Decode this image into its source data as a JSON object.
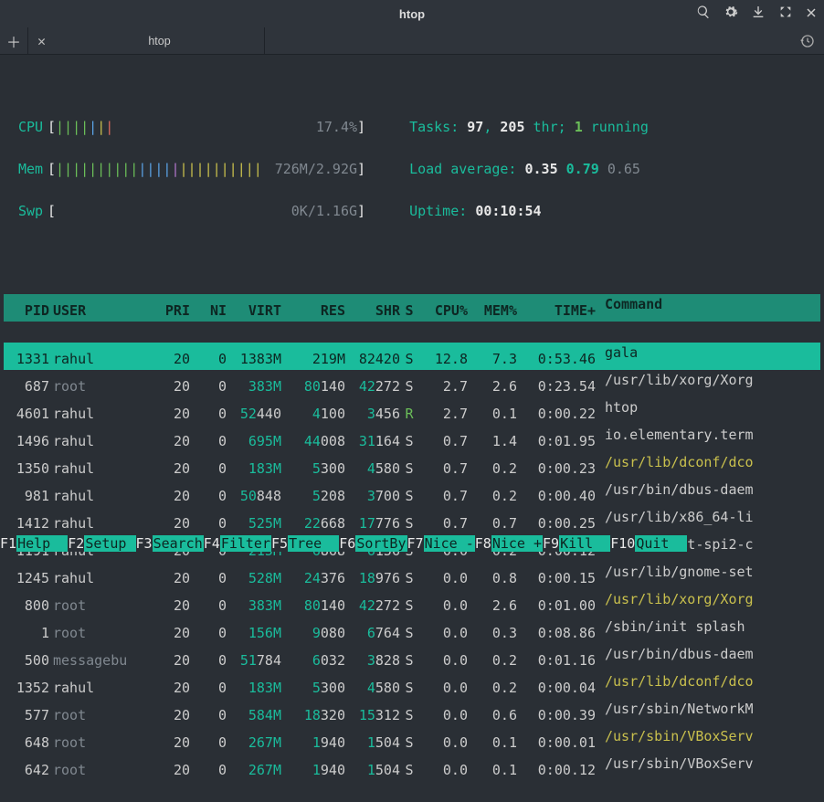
{
  "window": {
    "title": "htop"
  },
  "tab": {
    "label": "htop"
  },
  "meters": {
    "cpu": {
      "label": "CPU",
      "bars": "|||||||",
      "value": "17.4%"
    },
    "mem": {
      "label": "Mem",
      "bars": "|||||||||||||||||||||||||",
      "value": "726M/2.92G"
    },
    "swp": {
      "label": "Swp",
      "bars": "",
      "value": "0K/1.16G"
    }
  },
  "stats": {
    "tasks_label": "Tasks: ",
    "tasks_count": "97",
    "thr_label": ", ",
    "thr_count": "205",
    "thr_suffix": " thr; ",
    "running_count": "1",
    "running_label": " running",
    "load_label": "Load average: ",
    "load1": "0.35",
    "load5": "0.79",
    "load15": "0.65",
    "uptime_label": "Uptime: ",
    "uptime": "00:10:54"
  },
  "columns": {
    "pid": "PID",
    "user": "USER",
    "pri": "PRI",
    "ni": "NI",
    "virt": "VIRT",
    "res": "RES",
    "shr": "SHR",
    "s": "S",
    "cpu": "CPU%",
    "mem": "MEM%",
    "time": "TIME+",
    "cmd": "Command"
  },
  "processes": [
    {
      "pid": "1331",
      "user": "rahul",
      "user_cls": "",
      "pri": "20",
      "ni": "0",
      "virt_hi": "1383M",
      "virt_lo": "",
      "res_hi": "219M",
      "res_lo": "",
      "shr_hi": "82",
      "shr_lo": "420",
      "s": "S",
      "s_cls": "",
      "cpu": "12.8",
      "mem": "7.3",
      "time": "0:53.46",
      "cmd": "gala",
      "cmd_cls": "",
      "sel": true
    },
    {
      "pid": "687",
      "user": "root",
      "user_cls": "gr",
      "pri": "20",
      "ni": "0",
      "virt_hi": "383M",
      "virt_lo": "",
      "res_hi": "80",
      "res_lo": "140",
      "shr_hi": "42",
      "shr_lo": "272",
      "s": "S",
      "s_cls": "",
      "cpu": "2.7",
      "mem": "2.6",
      "time": "0:23.54",
      "cmd": "/usr/lib/xorg/Xorg",
      "cmd_cls": ""
    },
    {
      "pid": "4601",
      "user": "rahul",
      "user_cls": "",
      "pri": "20",
      "ni": "0",
      "virt_hi": "52",
      "virt_lo": "440",
      "res_hi": "4",
      "res_lo": "100",
      "shr_hi": "3",
      "shr_lo": "456",
      "s": "R",
      "s_cls": "grn",
      "cpu": "2.7",
      "mem": "0.1",
      "time": "0:00.22",
      "cmd": "htop",
      "cmd_cls": ""
    },
    {
      "pid": "1496",
      "user": "rahul",
      "user_cls": "",
      "pri": "20",
      "ni": "0",
      "virt_hi": "695M",
      "virt_lo": "",
      "res_hi": "44",
      "res_lo": "008",
      "shr_hi": "31",
      "shr_lo": "164",
      "s": "S",
      "s_cls": "",
      "cpu": "0.7",
      "mem": "1.4",
      "time": "0:01.95",
      "cmd": "io.elementary.term",
      "cmd_cls": ""
    },
    {
      "pid": "1350",
      "user": "rahul",
      "user_cls": "",
      "pri": "20",
      "ni": "0",
      "virt_hi": "183M",
      "virt_lo": "",
      "res_hi": "5",
      "res_lo": "300",
      "shr_hi": "4",
      "shr_lo": "580",
      "s": "S",
      "s_cls": "",
      "cpu": "0.7",
      "mem": "0.2",
      "time": "0:00.23",
      "cmd": "/usr/lib/dconf/dco",
      "cmd_cls": "ylw"
    },
    {
      "pid": "981",
      "user": "rahul",
      "user_cls": "",
      "pri": "20",
      "ni": "0",
      "virt_hi": "50",
      "virt_lo": "848",
      "res_hi": "5",
      "res_lo": "208",
      "shr_hi": "3",
      "shr_lo": "700",
      "s": "S",
      "s_cls": "",
      "cpu": "0.7",
      "mem": "0.2",
      "time": "0:00.40",
      "cmd": "/usr/bin/dbus-daem",
      "cmd_cls": ""
    },
    {
      "pid": "1412",
      "user": "rahul",
      "user_cls": "",
      "pri": "20",
      "ni": "0",
      "virt_hi": "525M",
      "virt_lo": "",
      "res_hi": "22",
      "res_lo": "668",
      "shr_hi": "17",
      "shr_lo": "776",
      "s": "S",
      "s_cls": "",
      "cpu": "0.7",
      "mem": "0.7",
      "time": "0:00.25",
      "cmd": "/usr/lib/x86_64-li",
      "cmd_cls": ""
    },
    {
      "pid": "1191",
      "user": "rahul",
      "user_cls": "",
      "pri": "20",
      "ni": "0",
      "virt_hi": "215M",
      "virt_lo": "",
      "res_hi": "6",
      "res_lo": "868",
      "shr_hi": "6",
      "shr_lo": "156",
      "s": "S",
      "s_cls": "",
      "cpu": "0.0",
      "mem": "0.2",
      "time": "0:00.12",
      "cmd": "/usr/lib/at-spi2-c",
      "cmd_cls": ""
    },
    {
      "pid": "1245",
      "user": "rahul",
      "user_cls": "",
      "pri": "20",
      "ni": "0",
      "virt_hi": "528M",
      "virt_lo": "",
      "res_hi": "24",
      "res_lo": "376",
      "shr_hi": "18",
      "shr_lo": "976",
      "s": "S",
      "s_cls": "",
      "cpu": "0.0",
      "mem": "0.8",
      "time": "0:00.15",
      "cmd": "/usr/lib/gnome-set",
      "cmd_cls": ""
    },
    {
      "pid": "800",
      "user": "root",
      "user_cls": "gr",
      "pri": "20",
      "ni": "0",
      "virt_hi": "383M",
      "virt_lo": "",
      "res_hi": "80",
      "res_lo": "140",
      "shr_hi": "42",
      "shr_lo": "272",
      "s": "S",
      "s_cls": "",
      "cpu": "0.0",
      "mem": "2.6",
      "time": "0:01.00",
      "cmd": "/usr/lib/xorg/Xorg",
      "cmd_cls": "ylw"
    },
    {
      "pid": "1",
      "user": "root",
      "user_cls": "gr",
      "pri": "20",
      "ni": "0",
      "virt_hi": "156M",
      "virt_lo": "",
      "res_hi": "9",
      "res_lo": "080",
      "shr_hi": "6",
      "shr_lo": "764",
      "s": "S",
      "s_cls": "",
      "cpu": "0.0",
      "mem": "0.3",
      "time": "0:08.86",
      "cmd": "/sbin/init splash",
      "cmd_cls": ""
    },
    {
      "pid": "500",
      "user": "messagebu",
      "user_cls": "gr",
      "pri": "20",
      "ni": "0",
      "virt_hi": "51",
      "virt_lo": "784",
      "res_hi": "6",
      "res_lo": "032",
      "shr_hi": "3",
      "shr_lo": "828",
      "s": "S",
      "s_cls": "",
      "cpu": "0.0",
      "mem": "0.2",
      "time": "0:01.16",
      "cmd": "/usr/bin/dbus-daem",
      "cmd_cls": ""
    },
    {
      "pid": "1352",
      "user": "rahul",
      "user_cls": "",
      "pri": "20",
      "ni": "0",
      "virt_hi": "183M",
      "virt_lo": "",
      "res_hi": "5",
      "res_lo": "300",
      "shr_hi": "4",
      "shr_lo": "580",
      "s": "S",
      "s_cls": "",
      "cpu": "0.0",
      "mem": "0.2",
      "time": "0:00.04",
      "cmd": "/usr/lib/dconf/dco",
      "cmd_cls": "ylw"
    },
    {
      "pid": "577",
      "user": "root",
      "user_cls": "gr",
      "pri": "20",
      "ni": "0",
      "virt_hi": "584M",
      "virt_lo": "",
      "res_hi": "18",
      "res_lo": "320",
      "shr_hi": "15",
      "shr_lo": "312",
      "s": "S",
      "s_cls": "",
      "cpu": "0.0",
      "mem": "0.6",
      "time": "0:00.39",
      "cmd": "/usr/sbin/NetworkM",
      "cmd_cls": ""
    },
    {
      "pid": "648",
      "user": "root",
      "user_cls": "gr",
      "pri": "20",
      "ni": "0",
      "virt_hi": "267M",
      "virt_lo": "",
      "res_hi": "1",
      "res_lo": "940",
      "shr_hi": "1",
      "shr_lo": "504",
      "s": "S",
      "s_cls": "",
      "cpu": "0.0",
      "mem": "0.1",
      "time": "0:00.01",
      "cmd": "/usr/sbin/VBoxServ",
      "cmd_cls": "ylw"
    },
    {
      "pid": "642",
      "user": "root",
      "user_cls": "gr",
      "pri": "20",
      "ni": "0",
      "virt_hi": "267M",
      "virt_lo": "",
      "res_hi": "1",
      "res_lo": "940",
      "shr_hi": "1",
      "shr_lo": "504",
      "s": "S",
      "s_cls": "",
      "cpu": "0.0",
      "mem": "0.1",
      "time": "0:00.12",
      "cmd": "/usr/sbin/VBoxServ",
      "cmd_cls": ""
    }
  ],
  "fkeys": [
    {
      "key": "F1",
      "label": "Help  "
    },
    {
      "key": "F2",
      "label": "Setup "
    },
    {
      "key": "F3",
      "label": "Search"
    },
    {
      "key": "F4",
      "label": "Filter"
    },
    {
      "key": "F5",
      "label": "Tree  "
    },
    {
      "key": "F6",
      "label": "SortBy"
    },
    {
      "key": "F7",
      "label": "Nice -"
    },
    {
      "key": "F8",
      "label": "Nice +"
    },
    {
      "key": "F9",
      "label": "Kill  "
    },
    {
      "key": "F10",
      "label": "Quit  "
    }
  ]
}
